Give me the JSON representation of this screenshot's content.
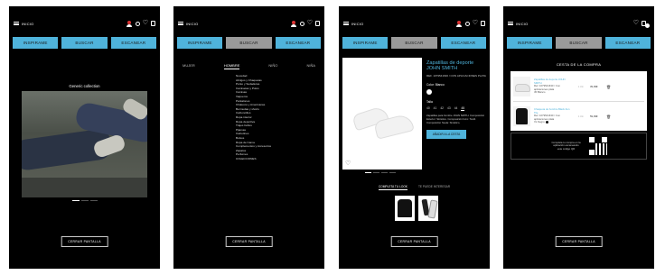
{
  "header": {
    "menu_label": "INICIO"
  },
  "buttons": {
    "inspire": "INSPIRAME",
    "search": "BUSCAR",
    "scan": "ESCANEAR"
  },
  "footer": {
    "close_label": "CERRAR PANTALLA"
  },
  "screen1": {
    "collection_title": "Generic collection"
  },
  "screen2": {
    "tabs": [
      "MUJER",
      "HOMBRE",
      "NIÑO",
      "NIÑA"
    ],
    "active_tab": "HOMBRE",
    "categories": [
      "Novedad",
      "Abrigos y Chaquetas",
      "Punto y Sudaderas",
      "Camisetas y Polos",
      "Camisas",
      "Vaqueros",
      "Pantalones",
      "Chalecos y Americanas",
      "Bermudas y shorts",
      "Calzoncillos",
      "Ropa interior",
      "Ropa deportiva",
      "Trajes baños",
      "Pijamas",
      "Calcetines",
      "Bolsos",
      "Ropa de Cama",
      "Complementos y Accesorios",
      "Zapatos",
      "Perfumes",
      "COLECCIONES"
    ]
  },
  "screen3": {
    "product_title": "Zapatillas de deporte JOHN SMITH",
    "ref": "REF. 1079541630 / CON APLICACIONES PLATA",
    "color_label": "Color: Blanco",
    "color_hex": "#ffffff",
    "size_label": "Talla",
    "sizes": [
      "40",
      "41",
      "42",
      "43",
      "44",
      "45"
    ],
    "selected_size": "45",
    "description": "Zapatillas para hombre JOHN SMITH. Composición Exterior: Sintético. Composición forro: Textil. Composición Suela: Sintético.",
    "add_label": "AÑADIR A LA CESTA",
    "look_tabs": [
      "COMPLETA TU LOOK",
      "TE PUEDE INTERESAR"
    ],
    "active_look_tab": "COMPLETA TU LOOK"
  },
  "screen4": {
    "cart_title": "CESTA DE LA COMPRA",
    "items": [
      {
        "name": "Zapatillas de deporte JOHN SMITH",
        "ref": "Ref. 1079541630 / Con aplicaciones plata",
        "attr": "45 Blanco",
        "qty": "1 Ud.",
        "price": "39,99€"
      },
      {
        "name": "Chaqueta de hombre Black Zen Tile",
        "ref": "Ref. 1079541630 / Con aplicaciones plata",
        "attr": "XL Negro",
        "qty": "1 Ud.",
        "price": "59,99€"
      }
    ],
    "qr_text": "Completa tu compra en la aplicación escaneando este código QR"
  }
}
